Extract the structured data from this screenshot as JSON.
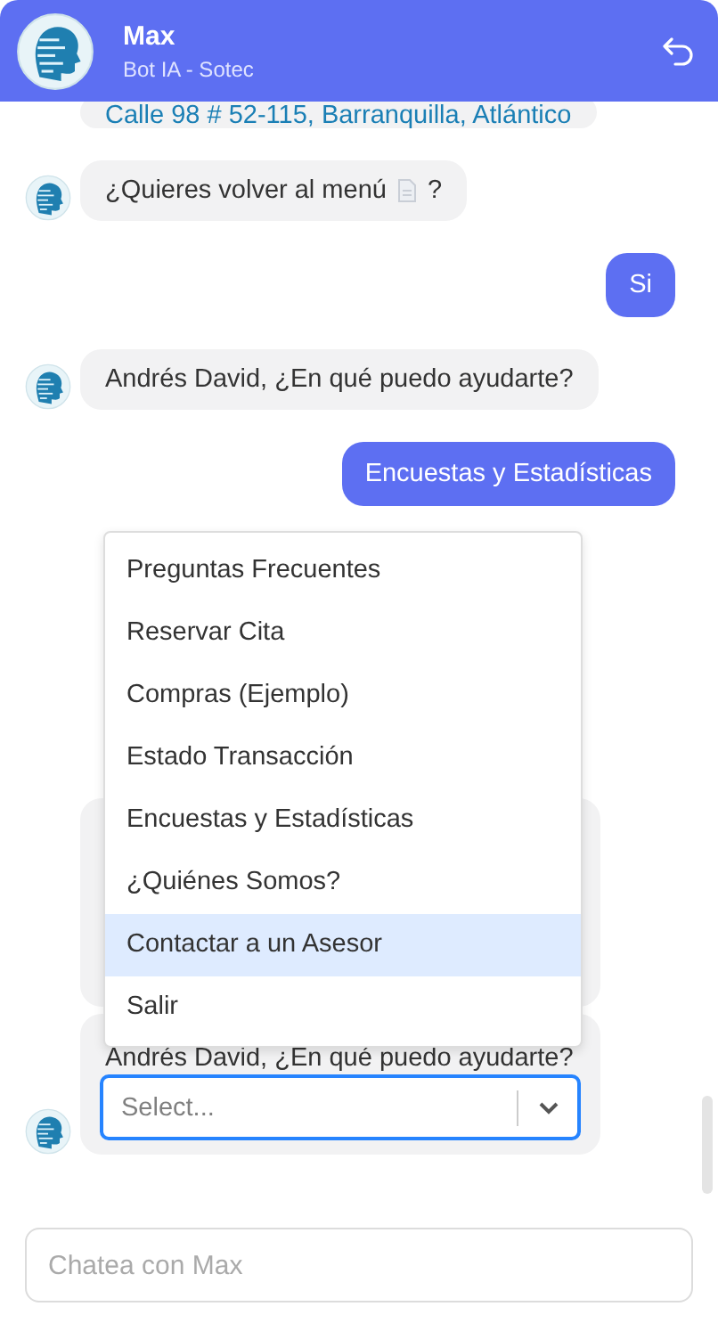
{
  "header": {
    "name": "Max",
    "subtitle": "Bot IA - Sotec"
  },
  "messages": [
    {
      "kind": "link",
      "text": "Calle 98 # 52-115, Barranquilla, Atlántico"
    },
    {
      "kind": "doc",
      "text": "¿Quieres volver al menú",
      "after": "?"
    },
    {
      "kind": "user",
      "text": "Si"
    },
    {
      "kind": "bot",
      "text": "Andrés David, ¿En qué puedo ayudarte?"
    },
    {
      "kind": "user",
      "text": "Encuestas y Estadísticas"
    },
    {
      "kind": "hidden"
    },
    {
      "kind": "select",
      "text": "Andrés David, ¿En qué puedo ayudarte?",
      "placeholder": "Select..."
    }
  ],
  "menu": [
    {
      "label": "Preguntas Frecuentes",
      "selected": false
    },
    {
      "label": "Reservar Cita",
      "selected": false
    },
    {
      "label": "Compras (Ejemplo)",
      "selected": false
    },
    {
      "label": "Estado Transacción",
      "selected": false
    },
    {
      "label": "Encuestas y Estadísticas",
      "selected": false
    },
    {
      "label": "¿Quiénes Somos?",
      "selected": false
    },
    {
      "label": "Contactar a un Asesor",
      "selected": true
    },
    {
      "label": "Salir",
      "selected": false
    }
  ],
  "composer": {
    "placeholder": "Chatea con Max"
  }
}
